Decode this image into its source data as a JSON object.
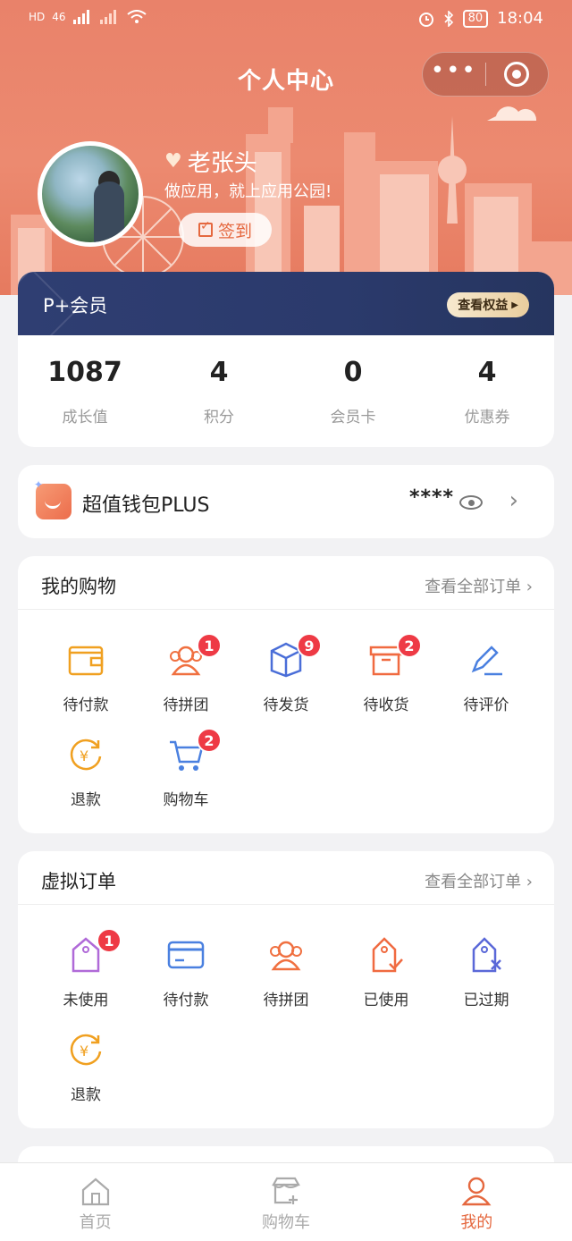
{
  "status_bar": {
    "time": "18:04",
    "battery": "80",
    "net": "46",
    "hd": "HD"
  },
  "header": {
    "title": "个人中心"
  },
  "user": {
    "name": "老张头",
    "slogan": "做应用，就上应用公园!",
    "checkin_label": "签到"
  },
  "member": {
    "title": "P+会员",
    "rights_button": "查看权益",
    "stats": [
      {
        "value": "1087",
        "label": "成长值"
      },
      {
        "value": "4",
        "label": "积分"
      },
      {
        "value": "0",
        "label": "会员卡"
      },
      {
        "value": "4",
        "label": "优惠券"
      }
    ]
  },
  "wallet": {
    "title": "超值钱包PLUS",
    "masked": "****"
  },
  "shopping": {
    "title": "我的购物",
    "more": "查看全部订单",
    "items": [
      {
        "label": "待付款",
        "icon": "wallet-icon",
        "badge": ""
      },
      {
        "label": "待拼团",
        "icon": "group-icon",
        "badge": "1"
      },
      {
        "label": "待发货",
        "icon": "box-icon",
        "badge": "9"
      },
      {
        "label": "待收货",
        "icon": "package-icon",
        "badge": "2"
      },
      {
        "label": "待评价",
        "icon": "pen-icon",
        "badge": ""
      },
      {
        "label": "退款",
        "icon": "refund-icon",
        "badge": ""
      },
      {
        "label": "购物车",
        "icon": "cart-icon",
        "badge": "2"
      }
    ]
  },
  "virtual": {
    "title": "虚拟订单",
    "more": "查看全部订单",
    "items": [
      {
        "label": "未使用",
        "icon": "tag-icon",
        "badge": "1"
      },
      {
        "label": "待付款",
        "icon": "card-icon",
        "badge": ""
      },
      {
        "label": "待拼团",
        "icon": "group-icon",
        "badge": ""
      },
      {
        "label": "已使用",
        "icon": "tag-check-icon",
        "badge": ""
      },
      {
        "label": "已过期",
        "icon": "tag-x-icon",
        "badge": ""
      },
      {
        "label": "退款",
        "icon": "refund-icon",
        "badge": ""
      }
    ]
  },
  "tabs": [
    {
      "label": "首页",
      "icon": "home-icon"
    },
    {
      "label": "购物车",
      "icon": "store-cart-icon"
    },
    {
      "label": "我的",
      "icon": "user-icon"
    }
  ],
  "colors": {
    "accent": "#e5683f",
    "badge": "#ee3a45",
    "member_bg": "#2f3e72"
  }
}
